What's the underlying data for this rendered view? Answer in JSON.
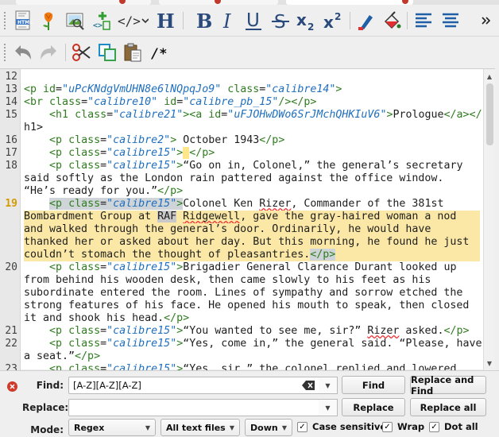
{
  "editor": {
    "lines": [
      {
        "num": "12",
        "rows": [
          ""
        ]
      },
      {
        "num": "13",
        "rows": [
          "<p id=\"uPcKNdgVmUHN8e6lNQpqJo9\" class=\"calibre14\">"
        ]
      },
      {
        "num": "14",
        "rows": [
          "<br class=\"calibre10\" id=\"calibre_pb_15\"/></p>"
        ]
      },
      {
        "num": "15",
        "rows": [
          "    <h1 class=\"calibre21\"><a id=\"uFJOHwDWo6SrJMchQHKIuV6\">Prologue</a></",
          "h1>"
        ]
      },
      {
        "num": "16",
        "rows": [
          "    <p class=\"calibre2\"> October 1943</p>"
        ]
      },
      {
        "num": "17",
        "rows": [
          "    <p class=\"calibre15\"> </p>"
        ]
      },
      {
        "num": "18",
        "rows": [
          "    <p class=\"calibre15\">“Go on in, Colonel,” the general’s secretary",
          "said softly as the London rain pattered against the office window.",
          "“He’s ready for you.”</p>"
        ]
      },
      {
        "num": "19",
        "rows": [
          "    <p class=\"calibre15\">Colonel Ken Rizer, Commander of the 381st",
          "Bombardment Group at RAF Ridgewell, gave the gray-haired woman a nod",
          "and walked through the general’s door. Ordinarily, he would have",
          "thanked her or asked about her day. But this morning, he found he just",
          "couldn’t stomach the thought of pleasantries.</p>"
        ]
      },
      {
        "num": "20",
        "rows": [
          "    <p class=\"calibre15\">Brigadier General Clarence Durant looked up",
          "from behind his wooden desk, then came slowly to his feet as his",
          "subordinate entered the room. Lines of sympathy and sorrow etched the",
          "strong features of his face. He opened his mouth to speak, then closed",
          "it and shook his head.</p>"
        ]
      },
      {
        "num": "21",
        "rows": [
          "    <p class=\"calibre15\">“You wanted to see me, sir?” Rizer asked.</p>"
        ]
      },
      {
        "num": "22",
        "rows": [
          "    <p class=\"calibre15\">“Yes, come in,” the general said. “Please, have",
          "a seat.”</p>"
        ]
      },
      {
        "num": "23",
        "rows": [
          "    <p class=\"calibre15\">“Yes, sir,” the colonel replied and lowered"
        ]
      }
    ],
    "current_line": "19",
    "highlight_match": "RAF"
  },
  "find_panel": {
    "find_label": "Find:",
    "find_value": "[A-Z][A-Z][A-Z]",
    "replace_label": "Replace:",
    "replace_value": "",
    "mode_label": "Mode:",
    "buttons": {
      "find": "Find",
      "replace_and_find": "Replace and Find",
      "replace": "Replace",
      "replace_all": "Replace all"
    },
    "mode_value": "Regex",
    "scope_value": "All text files",
    "direction_value": "Down",
    "case_sensitive": {
      "label": "Case sensitive",
      "checked": true
    },
    "wrap": {
      "label": "Wrap",
      "checked": true
    },
    "dot_all": {
      "label": "Dot all",
      "checked": true
    }
  },
  "toolbar_icons": {
    "row1": [
      "html-file-icon",
      "flower-icon",
      "image-view-icon",
      "insert-tag-icon",
      "code-tag-icon",
      "heading-icon",
      "bold-icon",
      "italic-icon",
      "underline-icon",
      "strikethrough-icon",
      "subscript-icon",
      "superscript-icon",
      "text-color-icon",
      "background-color-icon",
      "align-left-icon",
      "align-center-icon",
      "more-chevron-icon"
    ],
    "row2": [
      "undo-icon",
      "redo-icon",
      "cut-icon",
      "copy-icon",
      "paste-icon",
      "comment-icon"
    ]
  },
  "colors": {
    "tag": "#2e7d1e",
    "attr_value": "#1f6fbf",
    "current_line_bg": "#fbe8a6",
    "gutter_current": "#d49b00"
  }
}
